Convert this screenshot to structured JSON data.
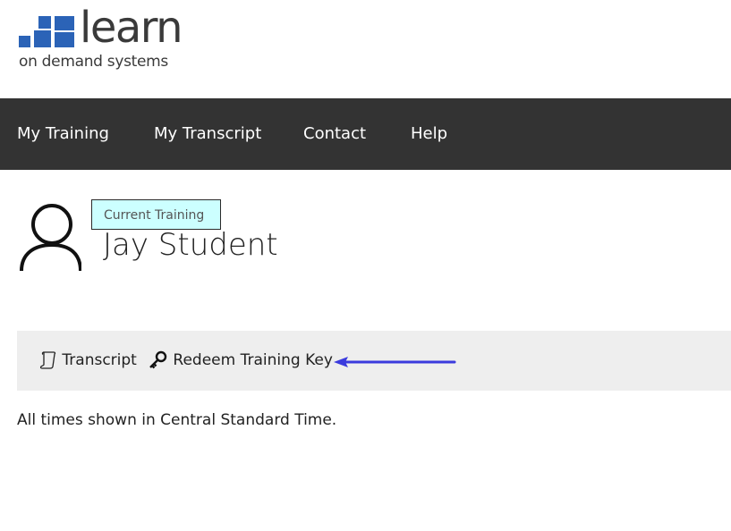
{
  "logo": {
    "word": "learn",
    "tagline": "on demand systems",
    "color": "#2b63b7"
  },
  "nav": {
    "items": [
      {
        "label": "My Training"
      },
      {
        "label": "My Transcript"
      },
      {
        "label": "Contact"
      },
      {
        "label": "Help"
      }
    ],
    "background": "#333333"
  },
  "profile": {
    "tooltip": "Current Training",
    "name": "Jay Student",
    "avatar_icon": "user-icon"
  },
  "actions": [
    {
      "label": "Transcript",
      "icon": "scroll-icon"
    },
    {
      "label": "Redeem Training Key",
      "icon": "key-icon"
    }
  ],
  "annotation": {
    "color": "#3b3bdd",
    "icon": "arrow-left-icon"
  },
  "timezone_note": "All times shown in Central Standard Time."
}
